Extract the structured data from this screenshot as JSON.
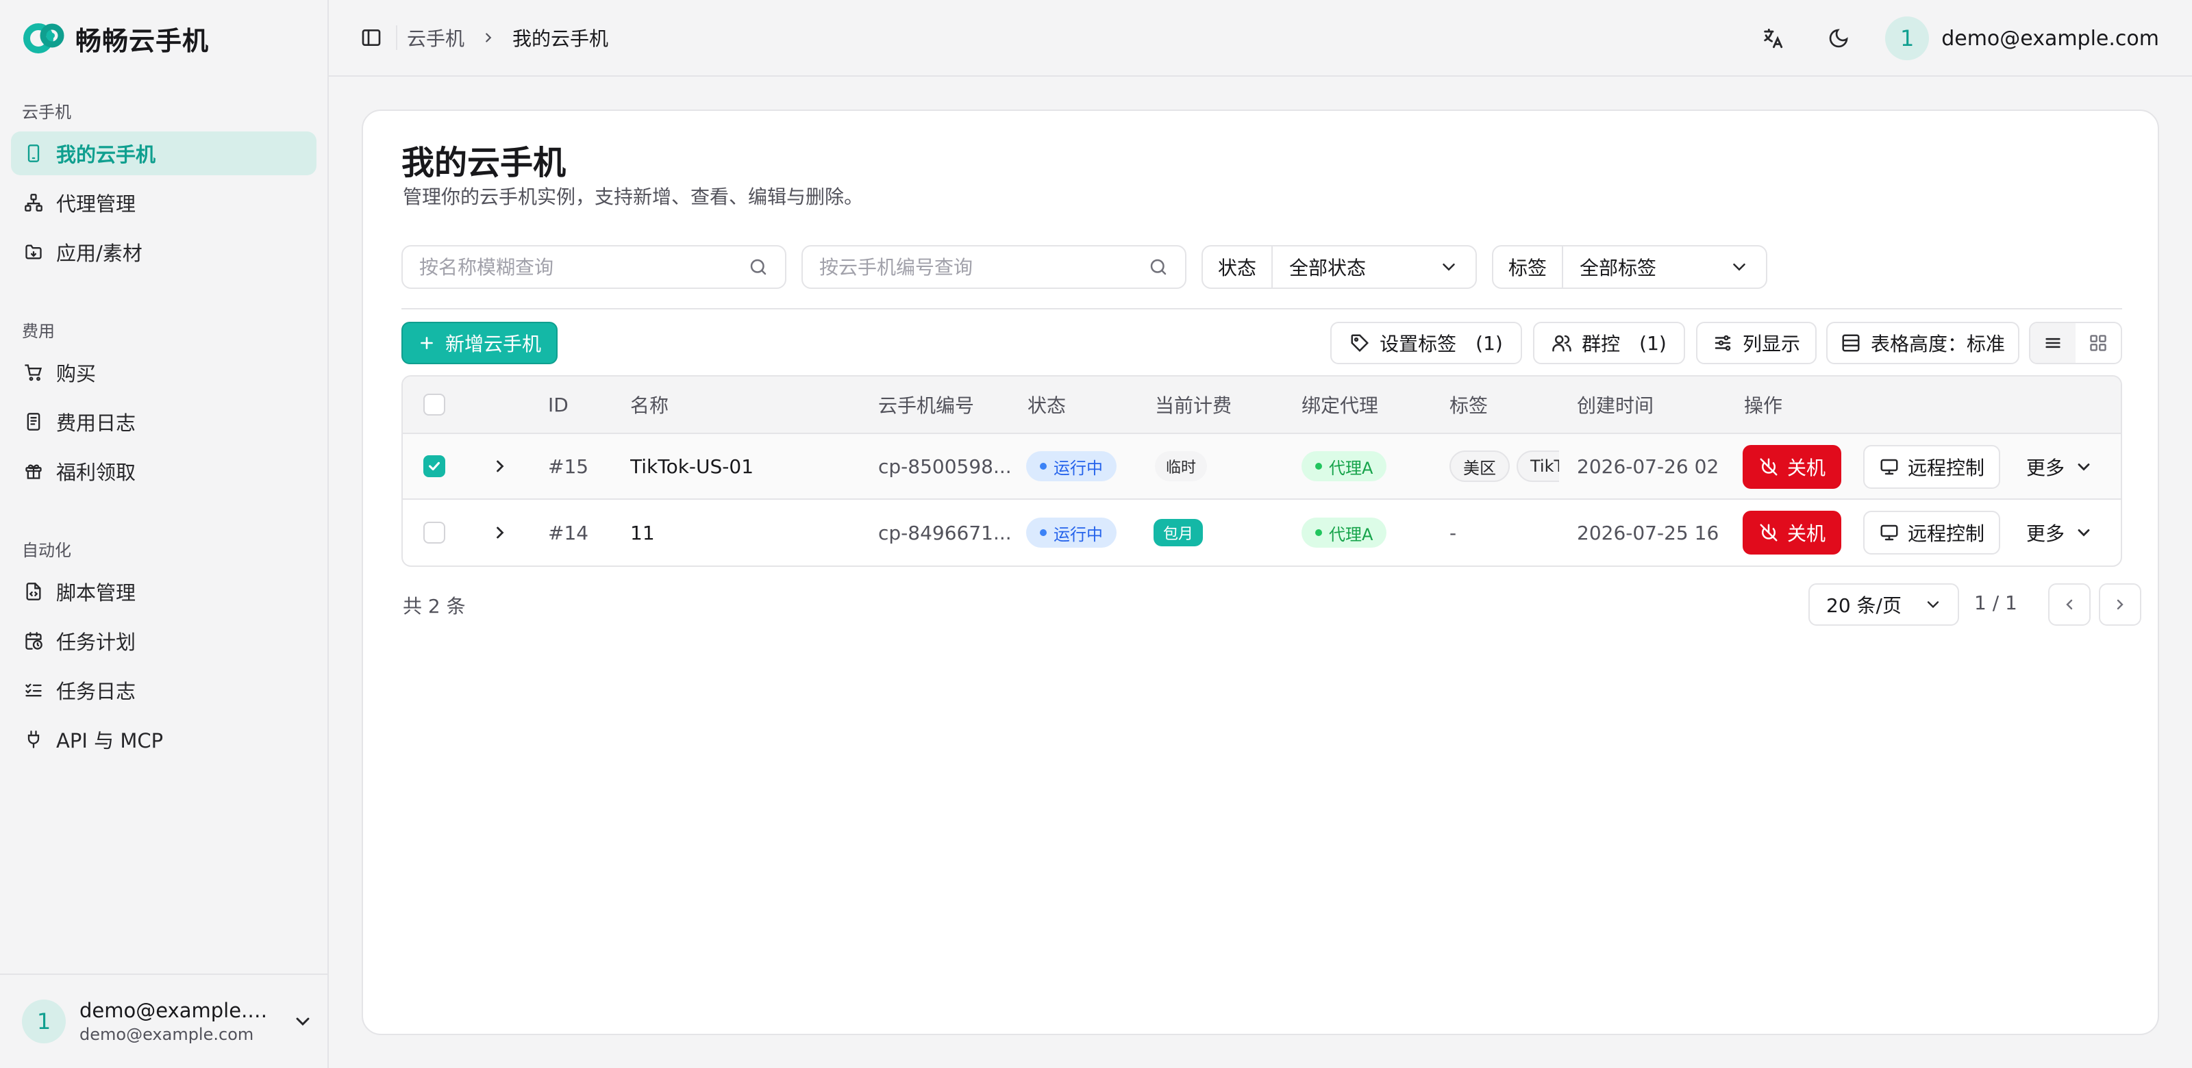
{
  "app": {
    "name": "畅畅云手机"
  },
  "sidebar": {
    "groups": [
      {
        "label": "云手机",
        "items": [
          {
            "label": "我的云手机",
            "icon": "phone-icon",
            "active": true
          },
          {
            "label": "代理管理",
            "icon": "network-icon"
          },
          {
            "label": "应用/素材",
            "icon": "folder-icon"
          }
        ]
      },
      {
        "label": "费用",
        "items": [
          {
            "label": "购买",
            "icon": "cart-icon"
          },
          {
            "label": "费用日志",
            "icon": "receipt-icon"
          },
          {
            "label": "福利领取",
            "icon": "gift-icon"
          }
        ]
      },
      {
        "label": "自动化",
        "items": [
          {
            "label": "脚本管理",
            "icon": "script-icon"
          },
          {
            "label": "任务计划",
            "icon": "calendar-clock-icon"
          },
          {
            "label": "任务日志",
            "icon": "list-checks-icon"
          },
          {
            "label": "API 与 MCP",
            "icon": "plug-icon"
          }
        ]
      }
    ],
    "user": {
      "avatar": "1",
      "name": "demo@example.com",
      "email": "demo@example.com"
    }
  },
  "header": {
    "breadcrumb": [
      "云手机",
      "我的云手机"
    ],
    "user": {
      "avatar": "1",
      "email": "demo@example.com"
    }
  },
  "page": {
    "title": "我的云手机",
    "subtitle": "管理你的云手机实例，支持新增、查看、编辑与删除。"
  },
  "filters": {
    "name_placeholder": "按名称模糊查询",
    "code_placeholder": "按云手机编号查询",
    "status": {
      "label": "状态",
      "value": "全部状态"
    },
    "tag": {
      "label": "标签",
      "value": "全部标签"
    }
  },
  "toolbar": {
    "add_label": "新增云手机",
    "set_tag_label": "设置标签",
    "set_tag_count": "(1)",
    "group_label": "群控",
    "group_count": "(1)",
    "columns_label": "列显示",
    "height_label": "表格高度：标准"
  },
  "table": {
    "headers": [
      "ID",
      "名称",
      "云手机编号",
      "状态",
      "当前计费",
      "绑定代理",
      "标签",
      "创建时间",
      "操作"
    ],
    "rows": [
      {
        "checked": true,
        "id": "#15",
        "name": "TikTok-US-01",
        "code": "cp-8500598...",
        "status": "运行中",
        "billing": "临时",
        "proxy": "代理A",
        "tags": [
          "美区",
          "TikTok"
        ],
        "created": "2026-07-26 02:..."
      },
      {
        "checked": false,
        "id": "#14",
        "name": "11",
        "code": "cp-8496671...",
        "status": "运行中",
        "billing": "包月",
        "proxy": "代理A",
        "tags_text": "-",
        "created": "2026-07-25 16:..."
      }
    ],
    "actions": {
      "off": "关机",
      "remote": "远程控制",
      "more": "更多"
    }
  },
  "footer": {
    "total": "共 2 条",
    "page_size": "20 条/页",
    "page_info": "1 / 1"
  },
  "colors": {
    "accent": "#14b8a6",
    "danger": "#e10b1c",
    "running": "#2563eb",
    "proxy": "#16a34a"
  }
}
